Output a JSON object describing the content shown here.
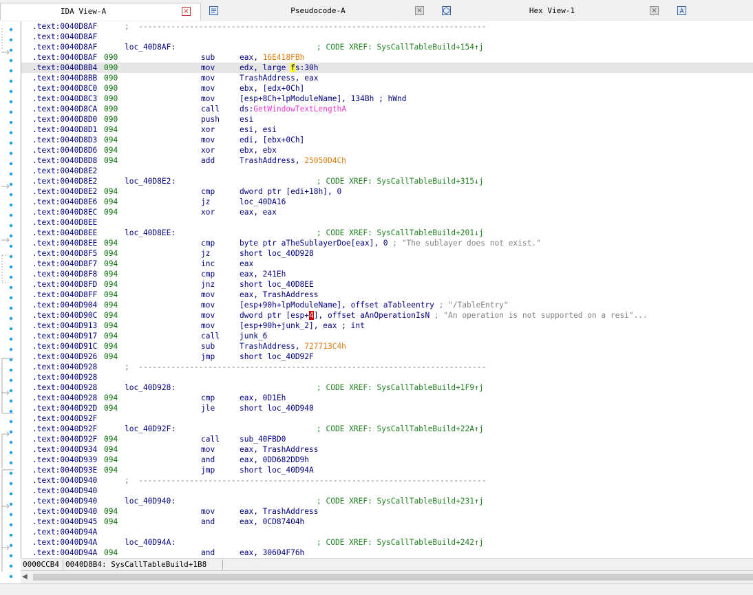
{
  "tabs": [
    {
      "label": "IDA View-A",
      "close": "×",
      "active": true
    },
    {
      "label": "Pseudocode-A",
      "close": "×",
      "active": false
    },
    {
      "label": "Hex View-1",
      "close": "×",
      "active": false
    },
    {
      "label": "",
      "close": "",
      "active": false
    }
  ],
  "listing": [
    {
      "addr": ".text:0040D8AF",
      "sep": ";  ---------------------------------------------------------------------------"
    },
    {
      "addr": ".text:0040D8AF"
    },
    {
      "addr": ".text:0040D8AF",
      "label": "loc_40D8AF:",
      "comment": "; CODE XREF: SysCallTableBuild+154↑j"
    },
    {
      "addr": ".text:0040D8AF",
      "sp": "090",
      "mn": "sub",
      "ops": [
        {
          "t": "eax, "
        },
        {
          "t": "16E418FBh",
          "c": "num"
        }
      ]
    },
    {
      "addr": ".text:0040D8B4",
      "sp": "090",
      "mn": "mov",
      "cur": true,
      "ops": [
        {
          "t": "edx, large "
        },
        {
          "t": "f",
          "c": "hl-y"
        },
        {
          "t": "s:30h"
        }
      ]
    },
    {
      "addr": ".text:0040D8BB",
      "sp": "090",
      "mn": "mov",
      "ops": [
        {
          "t": "TrashAddress, eax"
        }
      ]
    },
    {
      "addr": ".text:0040D8C0",
      "sp": "090",
      "mn": "mov",
      "ops": [
        {
          "t": "ebx, [edx+0Ch]"
        }
      ]
    },
    {
      "addr": ".text:0040D8C3",
      "sp": "090",
      "mn": "mov",
      "ops": [
        {
          "t": "[esp+8Ch+lpModuleName], 134Bh "
        },
        {
          "t": "; hWnd",
          "c": "cmtx"
        }
      ]
    },
    {
      "addr": ".text:0040D8CA",
      "sp": "090",
      "mn": "call",
      "ops": [
        {
          "t": "ds:"
        },
        {
          "t": "GetWindowTextLengthA",
          "c": "imp"
        }
      ]
    },
    {
      "addr": ".text:0040D8D0",
      "sp": "090",
      "mn": "push",
      "ops": [
        {
          "t": "esi"
        }
      ]
    },
    {
      "addr": ".text:0040D8D1",
      "sp": "094",
      "mn": "xor",
      "ops": [
        {
          "t": "esi, esi"
        }
      ]
    },
    {
      "addr": ".text:0040D8D3",
      "sp": "094",
      "mn": "mov",
      "ops": [
        {
          "t": "edi, [ebx+0Ch]"
        }
      ]
    },
    {
      "addr": ".text:0040D8D6",
      "sp": "094",
      "mn": "xor",
      "ops": [
        {
          "t": "ebx, ebx"
        }
      ]
    },
    {
      "addr": ".text:0040D8D8",
      "sp": "094",
      "mn": "add",
      "ops": [
        {
          "t": "TrashAddress, "
        },
        {
          "t": "25050D4Ch",
          "c": "num"
        }
      ]
    },
    {
      "addr": ".text:0040D8E2"
    },
    {
      "addr": ".text:0040D8E2",
      "label": "loc_40D8E2:",
      "comment": "; CODE XREF: SysCallTableBuild+315↓j"
    },
    {
      "addr": ".text:0040D8E2",
      "sp": "094",
      "mn": "cmp",
      "ops": [
        {
          "t": "dword ptr [edi+18h], 0"
        }
      ]
    },
    {
      "addr": ".text:0040D8E6",
      "sp": "094",
      "mn": "jz",
      "ops": [
        {
          "t": "loc_40DA16"
        }
      ]
    },
    {
      "addr": ".text:0040D8EC",
      "sp": "094",
      "mn": "xor",
      "ops": [
        {
          "t": "eax, eax"
        }
      ]
    },
    {
      "addr": ".text:0040D8EE"
    },
    {
      "addr": ".text:0040D8EE",
      "label": "loc_40D8EE:",
      "comment": "; CODE XREF: SysCallTableBuild+201↓j"
    },
    {
      "addr": ".text:0040D8EE",
      "sp": "094",
      "mn": "cmp",
      "ops": [
        {
          "t": "byte ptr aTheSublayerDoe[eax], 0 "
        },
        {
          "t": "; \"The sublayer does not exist.\"",
          "c": "str"
        }
      ]
    },
    {
      "addr": ".text:0040D8F5",
      "sp": "094",
      "mn": "jz",
      "ops": [
        {
          "t": "short loc_40D928"
        }
      ]
    },
    {
      "addr": ".text:0040D8F7",
      "sp": "094",
      "mn": "inc",
      "ops": [
        {
          "t": "eax"
        }
      ]
    },
    {
      "addr": ".text:0040D8F8",
      "sp": "094",
      "mn": "cmp",
      "ops": [
        {
          "t": "eax, 241Eh"
        }
      ]
    },
    {
      "addr": ".text:0040D8FD",
      "sp": "094",
      "mn": "jnz",
      "ops": [
        {
          "t": "short loc_40D8EE"
        }
      ]
    },
    {
      "addr": ".text:0040D8FF",
      "sp": "094",
      "mn": "mov",
      "ops": [
        {
          "t": "eax, TrashAddress"
        }
      ]
    },
    {
      "addr": ".text:0040D904",
      "sp": "094",
      "mn": "mov",
      "ops": [
        {
          "t": "[esp+90h+lpModuleName], offset aTableentry "
        },
        {
          "t": "; \"/TableEntry\"",
          "c": "str"
        }
      ]
    },
    {
      "addr": ".text:0040D90C",
      "sp": "094",
      "mn": "mov",
      "ops": [
        {
          "t": "dword ptr [esp+"
        },
        {
          "t": "4",
          "c": "hl-r"
        },
        {
          "t": "], offset aAnOperationIsN "
        },
        {
          "t": "; \"An operation is not supported on a resi\"...",
          "c": "str"
        }
      ]
    },
    {
      "addr": ".text:0040D913",
      "sp": "094",
      "mn": "mov",
      "ops": [
        {
          "t": "[esp+90h+junk_2], eax "
        },
        {
          "t": "; int",
          "c": "cmtx"
        }
      ]
    },
    {
      "addr": ".text:0040D917",
      "sp": "094",
      "mn": "call",
      "ops": [
        {
          "t": "junk_6"
        }
      ]
    },
    {
      "addr": ".text:0040D91C",
      "sp": "094",
      "mn": "sub",
      "ops": [
        {
          "t": "TrashAddress, "
        },
        {
          "t": "727713C4h",
          "c": "num"
        }
      ]
    },
    {
      "addr": ".text:0040D926",
      "sp": "094",
      "mn": "jmp",
      "ops": [
        {
          "t": "short loc_40D92F"
        }
      ]
    },
    {
      "addr": ".text:0040D928",
      "sep": ";  ---------------------------------------------------------------------------"
    },
    {
      "addr": ".text:0040D928"
    },
    {
      "addr": ".text:0040D928",
      "label": "loc_40D928:",
      "comment": "; CODE XREF: SysCallTableBuild+1F9↑j"
    },
    {
      "addr": ".text:0040D928",
      "sp": "094",
      "mn": "cmp",
      "ops": [
        {
          "t": "eax, 0D1Eh"
        }
      ]
    },
    {
      "addr": ".text:0040D92D",
      "sp": "094",
      "mn": "jle",
      "ops": [
        {
          "t": "short loc_40D940"
        }
      ]
    },
    {
      "addr": ".text:0040D92F"
    },
    {
      "addr": ".text:0040D92F",
      "label": "loc_40D92F:",
      "comment": "; CODE XREF: SysCallTableBuild+22A↑j"
    },
    {
      "addr": ".text:0040D92F",
      "sp": "094",
      "mn": "call",
      "ops": [
        {
          "t": "sub_40FBD0"
        }
      ]
    },
    {
      "addr": ".text:0040D934",
      "sp": "094",
      "mn": "mov",
      "ops": [
        {
          "t": "eax, TrashAddress"
        }
      ]
    },
    {
      "addr": ".text:0040D939",
      "sp": "094",
      "mn": "and",
      "ops": [
        {
          "t": "eax, 0DD682DD9h"
        }
      ]
    },
    {
      "addr": ".text:0040D93E",
      "sp": "094",
      "mn": "jmp",
      "ops": [
        {
          "t": "short loc_40D94A"
        }
      ]
    },
    {
      "addr": ".text:0040D940",
      "sep": ";  ---------------------------------------------------------------------------"
    },
    {
      "addr": ".text:0040D940"
    },
    {
      "addr": ".text:0040D940",
      "label": "loc_40D940:",
      "comment": "; CODE XREF: SysCallTableBuild+231↑j"
    },
    {
      "addr": ".text:0040D940",
      "sp": "094",
      "mn": "mov",
      "ops": [
        {
          "t": "eax, TrashAddress"
        }
      ]
    },
    {
      "addr": ".text:0040D945",
      "sp": "094",
      "mn": "and",
      "ops": [
        {
          "t": "eax, 0CD87404h"
        }
      ]
    },
    {
      "addr": ".text:0040D94A"
    },
    {
      "addr": ".text:0040D94A",
      "label": "loc_40D94A:",
      "comment": "; CODE XREF: SysCallTableBuild+242↑j"
    },
    {
      "addr": ".text:0040D94A",
      "sp": "094",
      "mn": "and",
      "ops": [
        {
          "t": "eax, 30604F76h"
        }
      ]
    }
  ],
  "status": {
    "offset": "0000CCB4",
    "location": "0040D8B4: SysCallTableBuild+1B8"
  },
  "colors": {
    "address": "#000080",
    "stack_pointer": "#007000",
    "comment": "#1e7f1e",
    "number": "#e07a10",
    "import": "#e83bd0",
    "string_comment": "#808080",
    "current_line": "#e6e6e6",
    "highlight": "#ffff00"
  }
}
